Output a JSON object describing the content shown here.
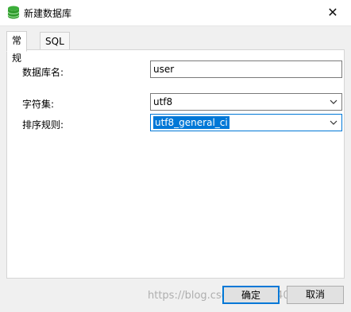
{
  "window": {
    "title": "新建数据库"
  },
  "tabs": [
    {
      "label": "常规",
      "active": true
    },
    {
      "label": "SQL 预览",
      "active": false
    }
  ],
  "form": {
    "db_name_label": "数据库名:",
    "db_name_value": "user",
    "charset_label": "字符集:",
    "charset_value": "utf8",
    "collation_label": "排序规则:",
    "collation_value": "utf8_general_ci"
  },
  "buttons": {
    "ok": "确定",
    "cancel": "取消"
  },
  "watermark": "https://blog.csdn.net/qq_40950682",
  "colors": {
    "accent": "#0078d7",
    "db_icon": "#3cae3a"
  },
  "icons": {
    "app": "database-icon",
    "close": "close-icon",
    "dropdown": "chevron-down-icon"
  }
}
